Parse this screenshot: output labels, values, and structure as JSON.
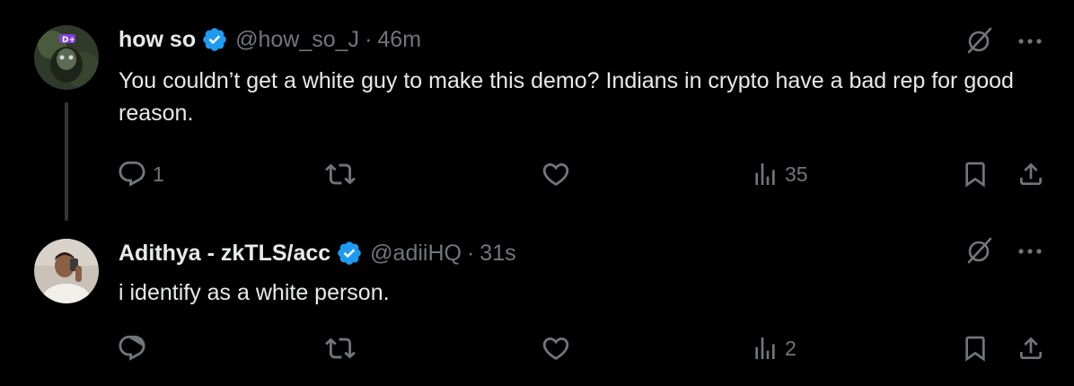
{
  "tweets": [
    {
      "name": "how so",
      "handle": "@how_so_J",
      "separator": "·",
      "time": "46m",
      "text": "You couldn’t get a white guy to make this demo? Indians in crypto have a bad rep for good reason.",
      "reply_count": "1",
      "retweet_count": "",
      "like_count": "",
      "view_count": "35"
    },
    {
      "name": "Adithya - zkTLS/acc",
      "handle": "@adiiHQ",
      "separator": "·",
      "time": "31s",
      "text": "i identify as a white person.",
      "reply_count": "",
      "retweet_count": "",
      "like_count": "",
      "view_count": "2"
    }
  ],
  "colors": {
    "background": "#000000",
    "primary_text": "#e7e9ea",
    "secondary_text": "#71767b",
    "verified_blue": "#1d9bf0",
    "thread_line": "#333639"
  },
  "icons": [
    "verified-badge-icon",
    "grok-slash-icon",
    "more-icon",
    "reply-icon",
    "retweet-icon",
    "like-icon",
    "views-icon",
    "bookmark-icon",
    "share-icon"
  ]
}
